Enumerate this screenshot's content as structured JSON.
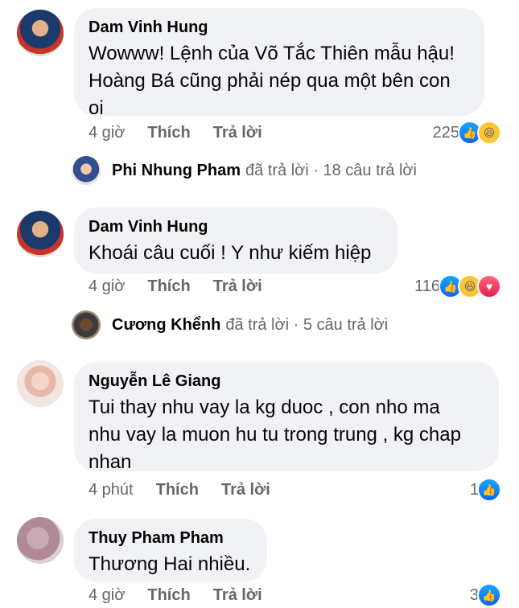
{
  "comments": [
    {
      "author": "Dam Vinh Hung",
      "lines": [
        "Wowww! Lệnh của Võ Tắc Thiên mẫu hậu!",
        "Hoàng Bá cũng phải nép qua một bên con",
        "oi"
      ],
      "time": "4 giờ",
      "like_label": "Thích",
      "reply_label": "Trả lời",
      "reaction_count": "225",
      "reactions": [
        "like-icon",
        "haha-icon"
      ]
    },
    {
      "author": "Dam Vinh Hung",
      "lines": [
        "Khoái câu cuối ! Y như kiếm hiệp"
      ],
      "time": "4 giờ",
      "like_label": "Thích",
      "reply_label": "Trả lời",
      "reaction_count": "116",
      "reactions": [
        "like-icon",
        "haha-icon",
        "love-icon"
      ]
    },
    {
      "author": "Nguyễn Lê Giang",
      "lines": [
        "Tui thay nhu vay la kg duoc , con nho ma",
        "nhu vay la muon hu tu trong trung , kg chap",
        "nhan"
      ],
      "time": "4 phút",
      "like_label": "Thích",
      "reply_label": "Trả lời",
      "reaction_count": "1",
      "reactions": [
        "like-icon"
      ]
    },
    {
      "author": "Thuy Pham Pham",
      "lines": [
        "Thương Hai nhiều."
      ],
      "time": "4 giờ",
      "like_label": "Thích",
      "reply_label": "Trả lời",
      "reaction_count": "3",
      "reactions": [
        "like-icon"
      ]
    }
  ],
  "replies": [
    {
      "name": "Phi Nhung Pham",
      "rest": "đã trả lời · 18 câu trả lời"
    },
    {
      "name": "Cương Khểnh",
      "rest": "đã trả lời · 5 câu trả lời"
    }
  ],
  "colors": {
    "bubble": "#f0f2f5",
    "meta": "#65676b",
    "like": "#0866ff",
    "text": "#050505"
  }
}
